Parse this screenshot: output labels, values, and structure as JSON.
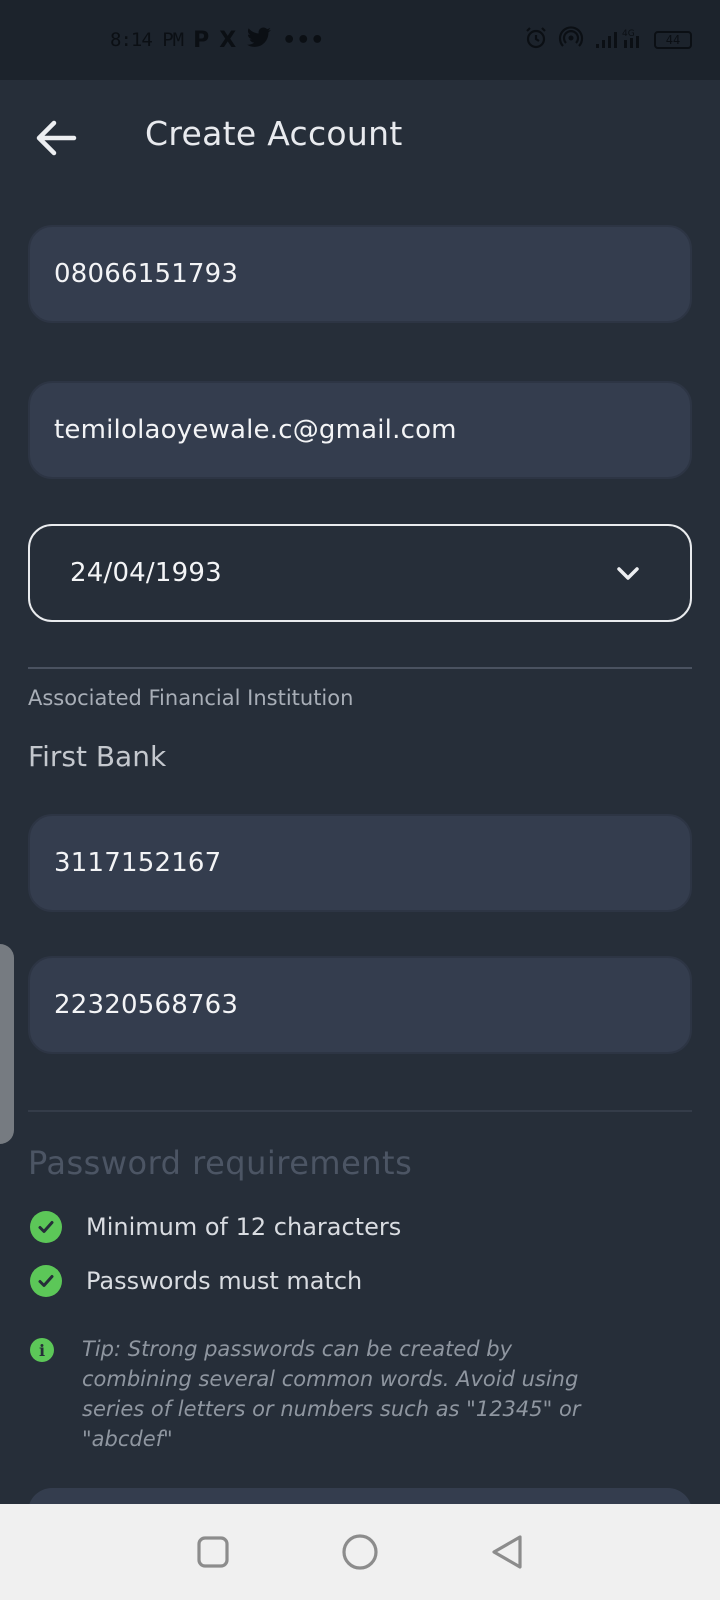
{
  "status_bar": {
    "time": "8:14 PM",
    "app_icons": [
      "P",
      "X",
      "twitter-bird",
      "•••"
    ],
    "battery": "44",
    "network": "4G"
  },
  "header": {
    "title": "Create Account"
  },
  "form": {
    "phone_value": "08066151793",
    "email_value": "temilolaoyewale.c@gmail.com",
    "dob_value": "24/04/1993",
    "institution_label": "Associated Financial Institution",
    "institution_value": "First Bank",
    "account_number_value": "3117152167",
    "bvn_value": "22320568763"
  },
  "password_requirements": {
    "heading": "Password requirements",
    "items": [
      {
        "label": "Minimum of 12 characters",
        "met": true
      },
      {
        "label": "Passwords must match",
        "met": true
      }
    ],
    "tip": "Tip: Strong passwords can be created by combining several common words. Avoid using series of letters or numbers such as \"12345\" or \"abcdef\""
  },
  "colors": {
    "background": "#262e39",
    "field": "#343d4e",
    "check": "#5cc758",
    "nav_bar": "#f0f0f0"
  }
}
